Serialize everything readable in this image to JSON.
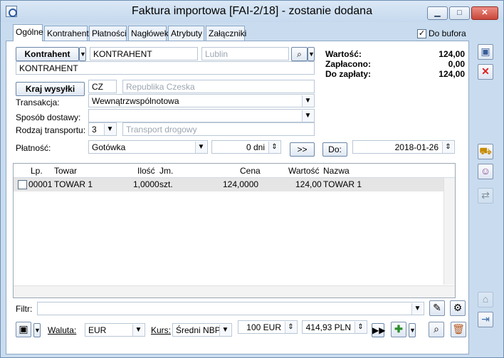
{
  "window": {
    "title": "Faktura importowa [FAI-2/18]  - zostanie dodana",
    "min": "▁",
    "max": "□",
    "close": "✕"
  },
  "tabs": [
    "Ogólne",
    "Kontrahent",
    "Płatności",
    "Nagłówek",
    "Atrybuty",
    "Załączniki"
  ],
  "do_bufora": {
    "label": "Do bufora",
    "checked": true
  },
  "contractor": {
    "button": "Kontrahent",
    "code": "KONTRAHENT",
    "city": "Lublin",
    "name": "KONTRAHENT"
  },
  "shipping": {
    "button": "Kraj wysyłki",
    "country_code": "CZ",
    "country_name": "Republika Czeska",
    "transaction_label": "Transakcja:",
    "transaction": "Wewnątrzwspólnotowa",
    "delivery_label": "Sposób dostawy:",
    "delivery": "",
    "transport_label": "Rodzaj transportu:",
    "transport_code": "3",
    "transport_name": "Transport drogowy"
  },
  "payment": {
    "label": "Płatność:",
    "method": "Gotówka",
    "days": "0 dni",
    "next_btn": ">>",
    "due_btn": "Do:",
    "due_date": "2018-01-26"
  },
  "summary": {
    "value_label": "Wartość:",
    "value": "124,00",
    "paid_label": "Zapłacono:",
    "paid": "0,00",
    "to_pay_label": "Do zapłaty:",
    "to_pay": "124,00"
  },
  "table": {
    "headers": [
      "Lp.",
      "Towar",
      "Ilość",
      "Jm.",
      "Cena",
      "Wartość",
      "Nazwa"
    ],
    "rows": [
      {
        "lp": "00001",
        "towar": "TOWAR 1",
        "ilosc": "1,0000",
        "jm": "szt.",
        "cena": "124,0000",
        "wartosc": "124,00",
        "nazwa": "TOWAR 1"
      }
    ]
  },
  "filter": {
    "label": "Filtr:",
    "value": ""
  },
  "currency": {
    "label": "Waluta:",
    "value": "EUR",
    "rate_label": "Kurs:",
    "rate_type": "Średni NBP",
    "amount_eur": "100 EUR",
    "amount_pln": "414,93 PLN"
  },
  "icons": {
    "save": "save-icon",
    "cancel": "cancel-icon",
    "search": "search-icon",
    "add": "add-icon",
    "delete": "trash-icon"
  }
}
